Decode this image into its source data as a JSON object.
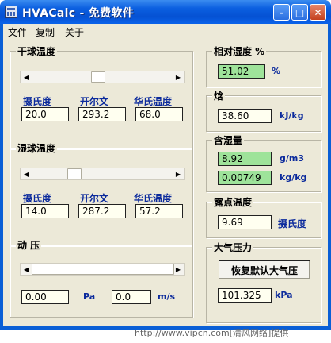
{
  "window": {
    "title": "HVACalc - 免费软件"
  },
  "menu": [
    "文件",
    "复制",
    "关于"
  ],
  "dry_bulb": {
    "title": "干球温度",
    "slider_fraction": 0.47,
    "labels": [
      "摄氏度",
      "开尔文",
      "华氏温度"
    ],
    "values": [
      "20.0",
      "293.2",
      "68.0"
    ]
  },
  "wet_bulb": {
    "title": "湿球温度",
    "slider_fraction": 0.28,
    "labels": [
      "摄氏度",
      "开尔文",
      "华氏温度"
    ],
    "values": [
      "14.0",
      "287.2",
      "57.2"
    ]
  },
  "dynamic_pressure": {
    "title": "动 压",
    "slider_fraction": 0.0,
    "pa_value": "0.00",
    "pa_unit": "Pa",
    "ms_value": "0.0",
    "ms_unit": "m/s"
  },
  "relative_humidity": {
    "title": "相对湿度 %",
    "value": "51.02",
    "unit": "%"
  },
  "enthalpy": {
    "title": "焓",
    "value": "38.60",
    "unit": "kJ/kg"
  },
  "moisture": {
    "title": "含湿量",
    "value1": "8.92",
    "unit1": "g/m3",
    "value2": "0.00749",
    "unit2": "kg/kg"
  },
  "dew_point": {
    "title": "露点温度",
    "value": "9.69",
    "unit": "摄氏度"
  },
  "atmosphere": {
    "title": "大气压力",
    "reset_label": "恢复默认大气压",
    "value": "101.325",
    "unit": "kPa"
  },
  "watermark": "http://www.vipcn.com[清风网络]提供",
  "colors": {
    "title_bar": "#0b5fe0",
    "client_bg": "#ece9d8",
    "label_blue": "#0b2a9c",
    "field_green": "#9ee39a",
    "field_yellow": "#fffff0"
  }
}
